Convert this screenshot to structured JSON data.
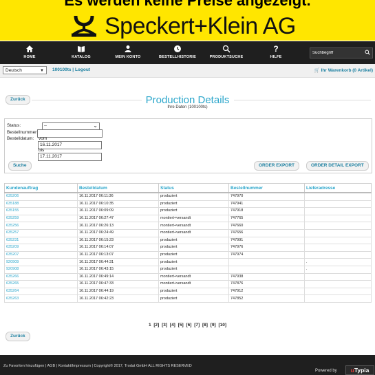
{
  "banner": {
    "overlay_text": "Es werden keine Preise angezeigt.",
    "brand_text": "Speckert+Klein AG",
    "colors": {
      "banner_bg": "#ffe600",
      "nav_bg": "#1f1f1f",
      "accent": "#2ba6cb"
    }
  },
  "nav": {
    "items": [
      {
        "label": "HOME",
        "icon": "home-icon"
      },
      {
        "label": "KATALOG",
        "icon": "catalog-icon"
      },
      {
        "label": "MEIN KONTO",
        "icon": "user-icon"
      },
      {
        "label": "BESTELLHISTORIE",
        "icon": "history-icon"
      },
      {
        "label": "PRODUKTSUCHE",
        "icon": "search-icon"
      },
      {
        "label": "HILFE",
        "icon": "help-icon"
      }
    ],
    "search_placeholder": "Suchbegriff"
  },
  "topbar": {
    "language": "Deutsch",
    "account_id": "100100ts",
    "separator": "|",
    "logout": "Logout",
    "cart": "Ihr Warenkorb (0 Artikel)"
  },
  "page": {
    "back_label": "Zurück",
    "title": "Production Details",
    "subtitle": "Ihre Daten (100100ts)"
  },
  "filter": {
    "status_label": "Status:",
    "status_value": "--",
    "bestellnummer_label": "Bestellnummer",
    "bestellnummer_value": "",
    "bestelldatum_label": "Bestelldatum:",
    "vom_label": "vom",
    "vom_value": "16.11.2017",
    "bis_label": "bis",
    "bis_value": "17.11.2017",
    "search_button": "Suche",
    "order_export": "ORDER EXPORT",
    "order_detail_export": "ORDER DETAIL EXPORT"
  },
  "table": {
    "columns": [
      "Kundenauftrag",
      "Bestelldatum",
      "Status",
      "Bestellnummer",
      "Lieferadresse"
    ],
    "rows": [
      [
        "635206",
        "16.11.2017 06:11:36",
        "produziert",
        "747970",
        ""
      ],
      [
        "635188",
        "16.11.2017 06:10:35",
        "produziert",
        "747941",
        ""
      ],
      [
        "635155",
        "16.11.2017 06:09:09",
        "produziert",
        "747918",
        ""
      ],
      [
        "635259",
        "16.11.2017 06:27:47",
        "montiert+versandt",
        "747765",
        ""
      ],
      [
        "635256",
        "16.11.2017 06:26:13",
        "montiert+versandt",
        "747660",
        ""
      ],
      [
        "635257",
        "16.11.2017 06:24:49",
        "montiert+versandt",
        "747656",
        ""
      ],
      [
        "635231",
        "16.11.2017 06:15:23",
        "produziert",
        "747991",
        ""
      ],
      [
        "635209",
        "16.11.2017 06:14:07",
        "produziert",
        "747976",
        ""
      ],
      [
        "635207",
        "16.11.2017 06:13:07",
        "produziert",
        "747974",
        ""
      ],
      [
        "920909",
        "16.11.2017 06:44:31",
        "produziert",
        "",
        "."
      ],
      [
        "920908",
        "16.11.2017 06:43:15",
        "produziert",
        "",
        "."
      ],
      [
        "635266",
        "16.11.2017 06:49:14",
        "montiert+versandt",
        "747938",
        ""
      ],
      [
        "635265",
        "16.11.2017 06:47:33",
        "montiert+versandt",
        "747876",
        ""
      ],
      [
        "635264",
        "16.11.2017 06:44:19",
        "produziert",
        "747912",
        ""
      ],
      [
        "635263",
        "16.11.2017 06:42:23",
        "produziert",
        "747852",
        ""
      ]
    ]
  },
  "pagination": {
    "current": "1",
    "pages": [
      "[2]",
      "[3]",
      "[4]",
      "[5]",
      "[6]",
      "[7]",
      "[8]",
      "[9]",
      "[10]"
    ]
  },
  "footer": {
    "links": "Zu Favoriten hinzufügen | AGB | Kontakt/Impressum | Copyright© 2017, Trodat GmbH ALL RIGHTS RESERVED",
    "powered_by": "Powered by",
    "brand_u": "u",
    "brand_rest": "Typia"
  }
}
